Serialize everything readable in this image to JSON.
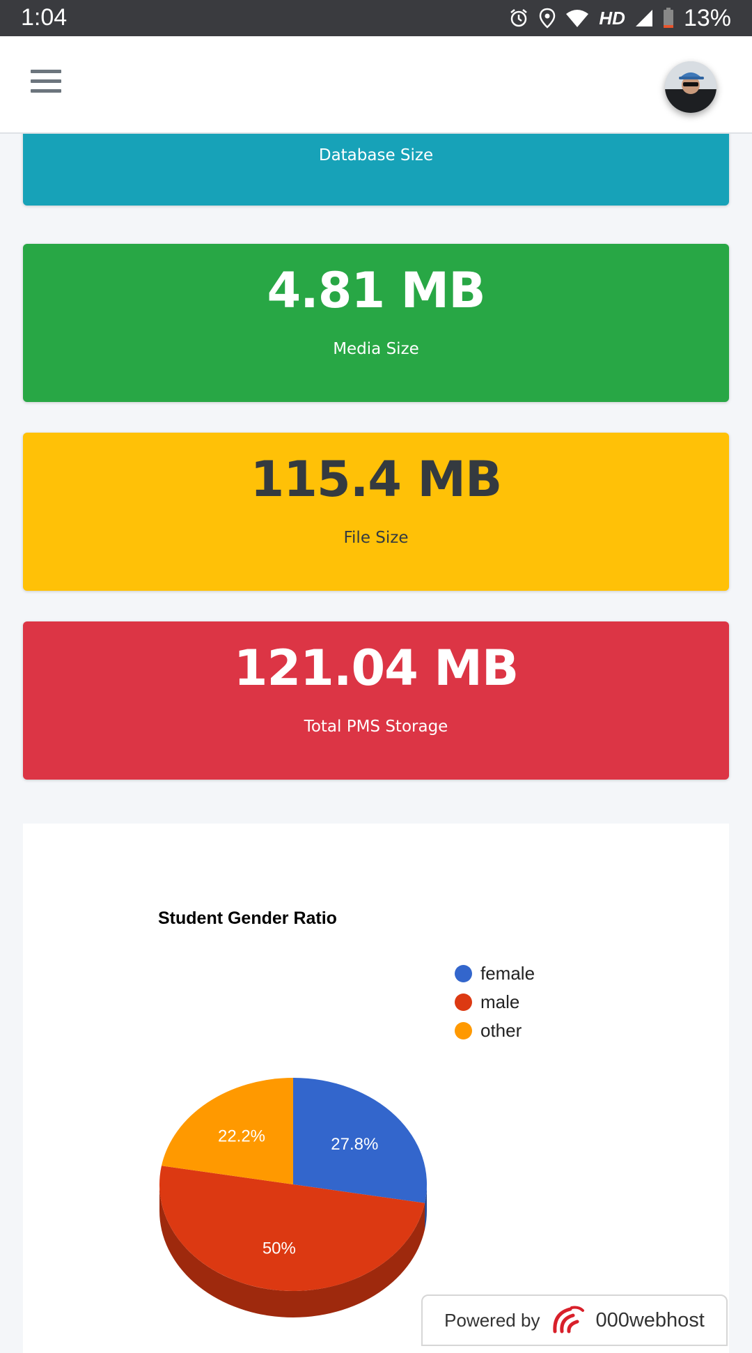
{
  "status_bar": {
    "time": "1:04",
    "hd": "HD",
    "battery": "13%"
  },
  "boxes": [
    {
      "value": "",
      "label": "Database Size",
      "bg": "#17a2b8",
      "fg": "#ffffff"
    },
    {
      "value": "4.81 MB",
      "label": "Media Size",
      "bg": "#28a745",
      "fg": "#ffffff"
    },
    {
      "value": "115.4 MB",
      "label": "File Size",
      "bg": "#ffc107",
      "fg": "#343a40"
    },
    {
      "value": "121.04 MB",
      "label": "Total PMS Storage",
      "bg": "#dc3545",
      "fg": "#ffffff"
    }
  ],
  "chart_data": {
    "type": "pie",
    "title": "Student Gender Ratio",
    "categories": [
      "female",
      "male",
      "other"
    ],
    "values": [
      27.8,
      50,
      22.2
    ],
    "value_labels": [
      "27.8%",
      "50%",
      "22.2%"
    ],
    "colors": [
      "#3366cc",
      "#dc3912",
      "#ff9900"
    ],
    "legend_position": "top-right",
    "style": "3d"
  },
  "footer": {
    "powered_text": "Powered by",
    "brand": "000webhost"
  }
}
